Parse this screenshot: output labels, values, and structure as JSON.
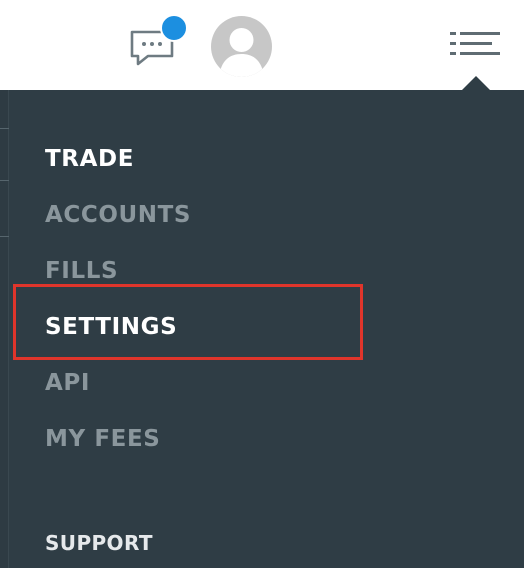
{
  "header": {
    "chat_icon": "chat-bubble-icon",
    "notification_icon": "notification-dot",
    "avatar_icon": "user-avatar-icon",
    "menu_icon": "hamburger-list-icon",
    "notification_color": "#1c8fe0"
  },
  "menu": {
    "items": [
      {
        "label": "TRADE",
        "active": true
      },
      {
        "label": "ACCOUNTS",
        "active": false
      },
      {
        "label": "FILLS",
        "active": false
      },
      {
        "label": "SETTINGS",
        "active": true
      },
      {
        "label": "API",
        "active": false
      },
      {
        "label": "MY FEES",
        "active": false
      }
    ],
    "support_label": "SUPPORT",
    "background_color": "#2f3d45",
    "highlight_color": "#e0352b"
  }
}
